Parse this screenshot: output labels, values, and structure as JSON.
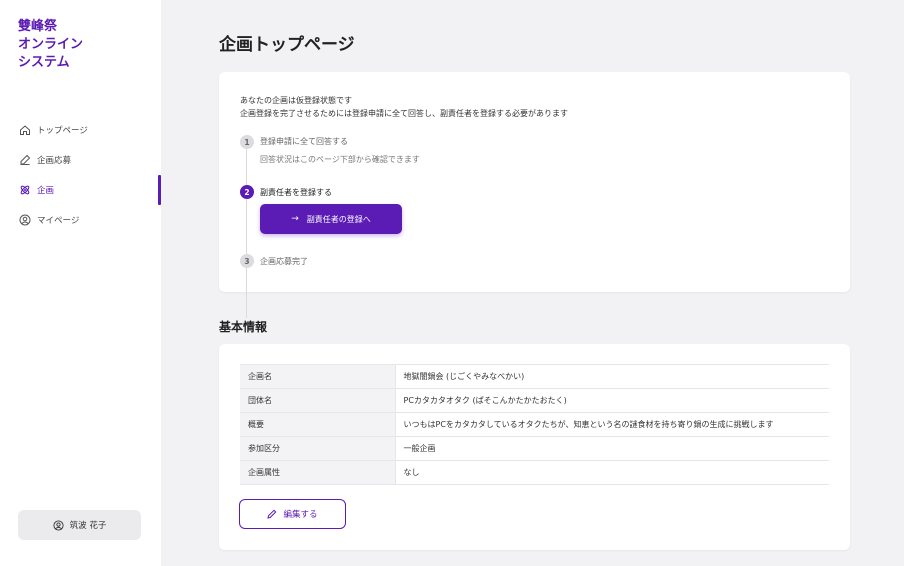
{
  "app": {
    "logo_lines": [
      "雙峰祭",
      "オンライン",
      "システム"
    ]
  },
  "sidebar": {
    "items": [
      {
        "label": "トップページ",
        "icon": "home-icon"
      },
      {
        "label": "企画応募",
        "icon": "edit-icon"
      },
      {
        "label": "企画",
        "icon": "atom-icon",
        "active": true
      },
      {
        "label": "マイページ",
        "icon": "user-circle-icon"
      }
    ],
    "user_name": "筑波 花子"
  },
  "page": {
    "title": "企画トップページ"
  },
  "status": {
    "message_line1": "あなたの企画は仮登録状態です",
    "message_line2": "企画登録を完了させるためには登録申請に全て回答し、副責任者を登録する必要があります",
    "steps": [
      {
        "number": "1",
        "label": "登録申請に全て回答する",
        "desc": "回答状況はこのページ下部から確認できます"
      },
      {
        "number": "2",
        "label": "副責任者を登録する",
        "button": "副責任者の登録へ"
      },
      {
        "number": "3",
        "label": "企画応募完了"
      }
    ]
  },
  "basic_info": {
    "title": "基本情報",
    "rows": [
      {
        "key": "企画名",
        "value": "地獄闇鍋会 (じごくやみなべかい)"
      },
      {
        "key": "団体名",
        "value": "PCカタカタオタク (ぱそこんかたかたおたく)"
      },
      {
        "key": "概要",
        "value": "いつもはPCをカタカタしているオタクたちが、知恵という名の謎食材を持ち寄り鍋の生成に挑戦します"
      },
      {
        "key": "参加区分",
        "value": "一般企画"
      },
      {
        "key": "企画属性",
        "value": "なし"
      }
    ],
    "edit_label": "編集する"
  },
  "colors": {
    "accent": "#5b1bb5",
    "background": "#f2f1f4"
  }
}
